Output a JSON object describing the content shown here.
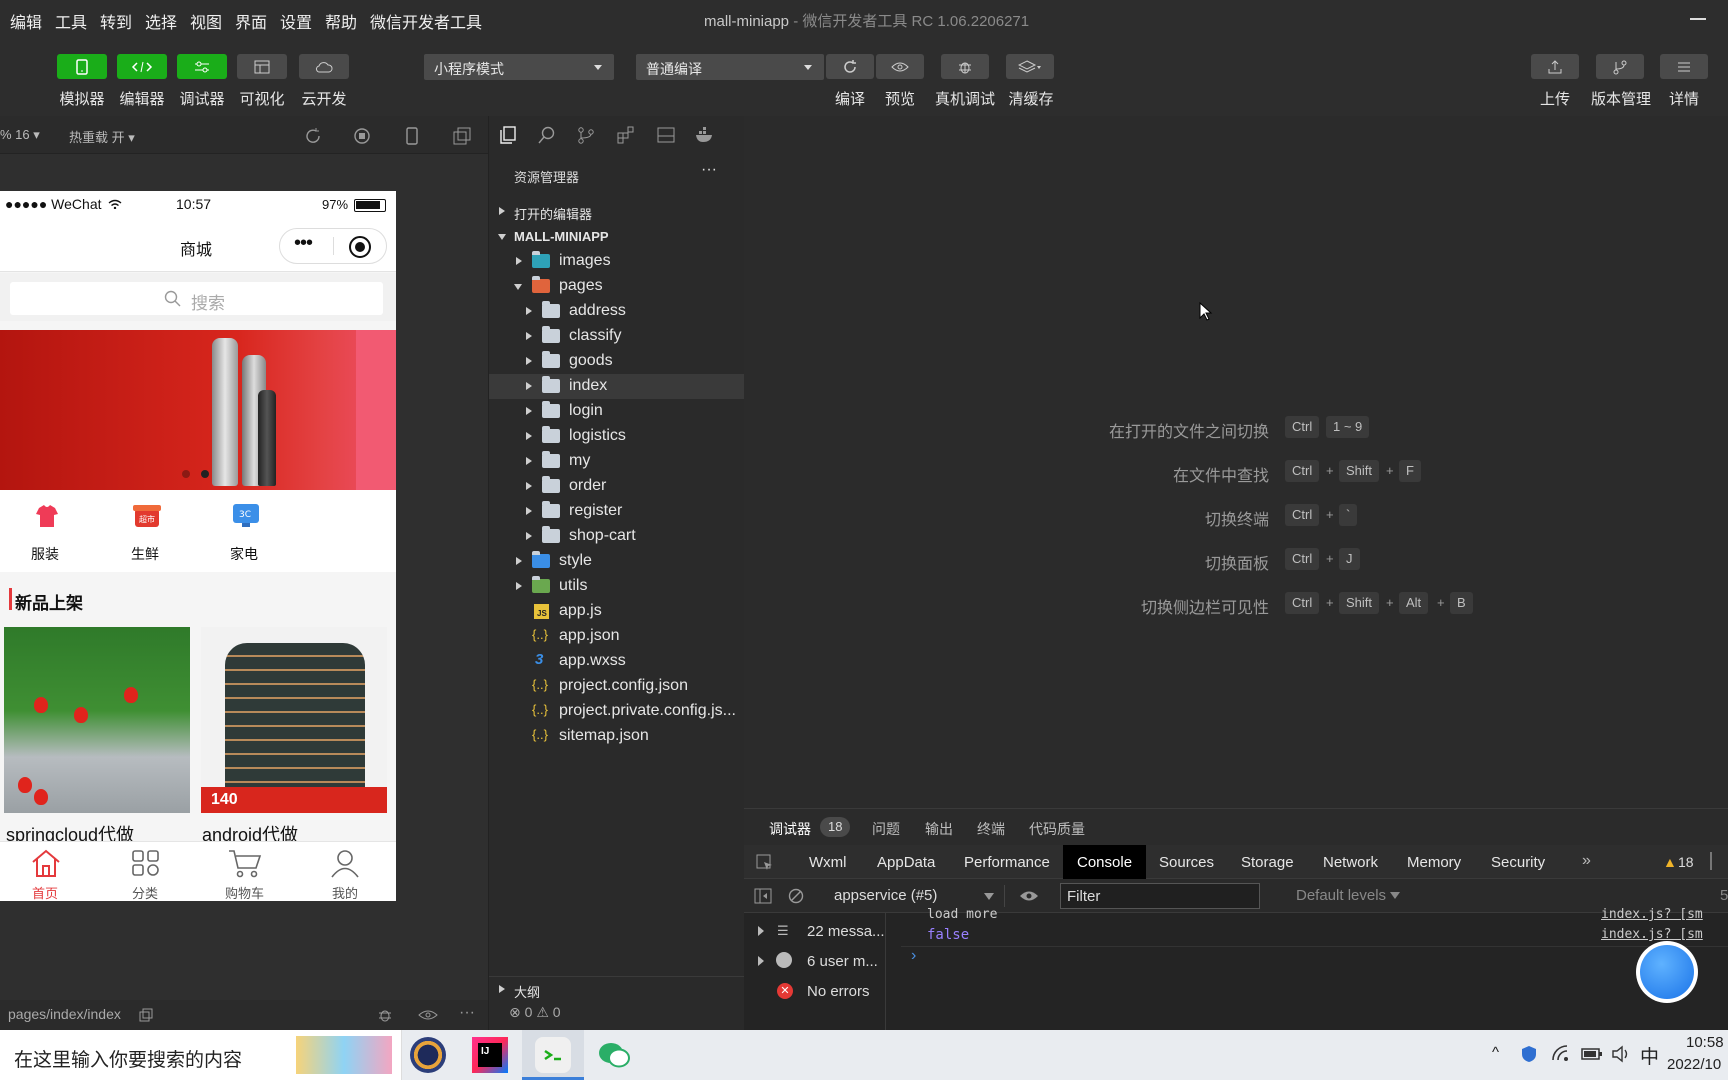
{
  "menu": {
    "items": [
      "编辑",
      "工具",
      "转到",
      "选择",
      "视图",
      "界面",
      "设置",
      "帮助",
      "微信开发者工具"
    ],
    "title_project": "mall-miniapp",
    "title_app": " - 微信开发者工具 RC 1.06.2206271"
  },
  "toolbar": {
    "simulator": "模拟器",
    "editor": "编辑器",
    "debugger": "调试器",
    "visual": "可视化",
    "cloud": "云开发",
    "mode_select": "小程序模式",
    "compile_select": "普通编译",
    "compile": "编译",
    "preview": "预览",
    "remote_debug": "真机调试",
    "clear_cache": "清缓存",
    "upload": "上传",
    "version": "版本管理",
    "details": "详情"
  },
  "simulator": {
    "zoom": "% 16 ▾",
    "hot_reload": "热重载 开 ▾",
    "status_signal": "●●●●● WeChat",
    "status_time": "10:57",
    "status_battery": "97%",
    "nav_title": "商城",
    "search_placeholder": "搜索",
    "categories": [
      {
        "label": "服装",
        "icon": "shirt-icon",
        "color": "#ef3b57"
      },
      {
        "label": "生鲜",
        "icon": "market-icon",
        "color": "#e23a2e"
      },
      {
        "label": "家电",
        "icon": "appliance-icon",
        "color": "#3b8fe8"
      }
    ],
    "section_title": "新品上架",
    "products": [
      "springcloud代做",
      "android代做"
    ],
    "product_badge_price": "140",
    "tabbar": [
      "首页",
      "分类",
      "购物车",
      "我的"
    ],
    "active_tab_color": "#e4393c",
    "page_path": "pages/index/index"
  },
  "explorer": {
    "title": "资源管理器",
    "more": "···",
    "open_editors": "打开的编辑器",
    "project": "MALL-MINIAPP",
    "tree": {
      "images": "images",
      "pages": "pages",
      "address": "address",
      "classify": "classify",
      "goods": "goods",
      "index": "index",
      "login": "login",
      "logistics": "logistics",
      "my": "my",
      "order": "order",
      "register": "register",
      "shopcart": "shop-cart",
      "style": "style",
      "utils": "utils",
      "appjs": "app.js",
      "appjson": "app.json",
      "appwxss": "app.wxss",
      "projconfig": "project.config.json",
      "projprivate": "project.private.config.js...",
      "sitemap": "sitemap.json"
    },
    "outline": "大纲",
    "errors": "0",
    "warnings": "0"
  },
  "editor_hints": [
    {
      "label": "在打开的文件之间切换",
      "keys": [
        "Ctrl",
        "1 ~ 9"
      ]
    },
    {
      "label": "在文件中查找",
      "keys": [
        "Ctrl",
        "Shift",
        "F"
      ]
    },
    {
      "label": "切换终端",
      "keys": [
        "Ctrl",
        "`"
      ]
    },
    {
      "label": "切换面板",
      "keys": [
        "Ctrl",
        "J"
      ]
    },
    {
      "label": "切换侧边栏可见性",
      "keys": [
        "Ctrl",
        "Shift",
        "Alt",
        "B"
      ]
    }
  ],
  "debugger": {
    "tabs": [
      "调试器",
      "问题",
      "输出",
      "终端",
      "代码质量"
    ],
    "badge": "18",
    "devtools_tabs": [
      "Wxml",
      "AppData",
      "Performance",
      "Console",
      "Sources",
      "Storage",
      "Network",
      "Memory",
      "Security"
    ],
    "warn_count": "18",
    "context": "appservice (#5)",
    "filter_placeholder": "Filter",
    "levels": "Default levels",
    "sidebar": [
      "22 messa...",
      "6 user m...",
      "No errors"
    ],
    "log_prev": "load more",
    "log_value": "false",
    "log_source": "index.js? [sm",
    "log_source2": "index.js? [sm",
    "right_edge": "5"
  },
  "taskbar": {
    "search_placeholder": "在这里输入你要搜索的内容",
    "ime": "中",
    "time": "10:58",
    "date": "2022/10"
  }
}
